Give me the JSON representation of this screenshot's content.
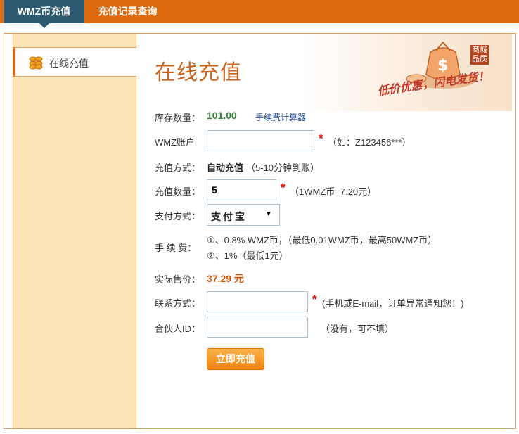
{
  "tabs": [
    {
      "label": "WMZ币充值"
    },
    {
      "label": "充值记录查询"
    }
  ],
  "sidebar": {
    "item_label": "在线充值",
    "item_icon": "coins-icon"
  },
  "header": {
    "title": "在线充值",
    "badge": "商城品质",
    "slogan": "低价优惠，闪电发货！",
    "banner_icon": "money-bag-icon"
  },
  "form": {
    "stock_label": "库存数量：",
    "stock_value": "101.00",
    "fee_calc_link": "手续费计算器",
    "account_label": "WMZ账户",
    "account_value": "",
    "account_hint": "（如：Z123456***）",
    "method_label": "充值方式：",
    "method_value": "自动充值",
    "method_note": "（5-10分钟到账）",
    "qty_label": "充值数量：",
    "qty_value": "5",
    "qty_hint": "（1WMZ币=7.20元）",
    "pay_label": "支付方式：",
    "pay_value": "支付宝",
    "fee_label": "手 续 费：",
    "fee_line1": "①、0.8% WMZ币，（最低0.01WMZ币，最高50WMZ币）",
    "fee_line2": "②、1%（最低1元）",
    "price_label": "实际售价：",
    "price_value": "37.29 元",
    "contact_label": "联系方式：",
    "contact_value": "",
    "contact_hint": "(手机或E-mail，订单异常通知您！)",
    "partner_label": "合伙人ID：",
    "partner_value": "",
    "partner_hint": "（没有，可不填）",
    "required_mark": "*",
    "submit_label": "立即充值"
  },
  "colors": {
    "brand_orange": "#e06a10",
    "active_tab": "#2d5a70",
    "sidebar_bg": "#fde5b8",
    "title": "#c8641e",
    "stock_green": "#2e7d32",
    "price_orange": "#d35400"
  }
}
